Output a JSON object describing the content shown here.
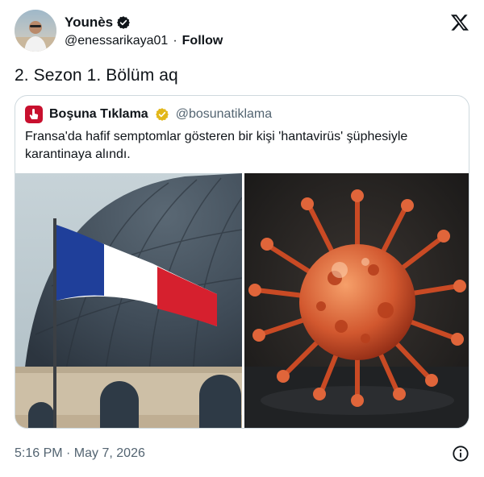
{
  "author": {
    "display_name": "Younès",
    "handle": "@enessarikaya01",
    "separator": "·",
    "follow_label": "Follow"
  },
  "tweet": {
    "text": "2. Sezon 1. Bölüm aq",
    "timestamp": "5:16 PM · May 7, 2026"
  },
  "quoted": {
    "display_name": "Boşuna Tıklama",
    "handle": "@bosunatiklama",
    "text": "Fransa'da hafif semptomlar gösteren bir kişi 'hantavirüs' şüphesiyle karantinaya alındı."
  },
  "icons": {
    "verified": "verified-badge-icon",
    "verified_gold": "gold-verified-badge-icon",
    "x_logo": "x-logo-icon",
    "info": "info-icon"
  },
  "colors": {
    "verified_blue": "#1d9bf0",
    "verified_gold": "#e2b719",
    "quote_brand": "#c8102e",
    "muted_text": "#536471"
  }
}
